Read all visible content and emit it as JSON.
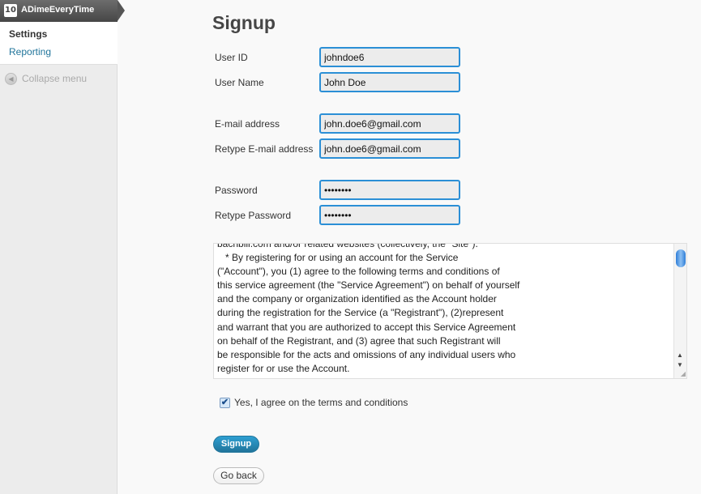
{
  "sidebar": {
    "plugin_icon": "adime-logo-icon",
    "plugin_icon_text": "10",
    "plugin_title": "ADimeEveryTime",
    "items": [
      {
        "label": "Settings",
        "current": true
      },
      {
        "label": "Reporting",
        "current": false
      }
    ],
    "collapse": {
      "icon": "collapse-arrow-icon",
      "label": "Collapse menu"
    }
  },
  "main": {
    "title": "Signup",
    "fields": {
      "user_id": {
        "label": "User ID",
        "value": "johndoe6"
      },
      "user_name": {
        "label": "User Name",
        "value": "John Doe"
      },
      "email": {
        "label": "E-mail address",
        "value": "john.doe6@gmail.com"
      },
      "email_confirm": {
        "label": "Retype E-mail address",
        "value": "john.doe6@gmail.com"
      },
      "password": {
        "label": "Password",
        "value": "xxxxxxxx"
      },
      "password_confirm": {
        "label": "Retype Password",
        "value": "xxxxxxxx"
      }
    },
    "terms_text": "bachbill.com and/or related websites (collectively, the \"Site\").\n   * By registering for or using an account for the Service\n(\"Account\"), you (1) agree to the following terms and conditions of\nthis service agreement (the \"Service Agreement\") on behalf of yourself\nand the company or organization identified as the Account holder\nduring the registration for the Service (a \"Registrant\"), (2)represent\nand warrant that you are authorized to accept this Service Agreement\non behalf of the Registrant, and (3) agree that such Registrant will\nbe responsible for the acts and omissions of any individual users who\nregister for or use the Account.",
    "agree": {
      "checked": true,
      "check_mark": "✔",
      "label": "Yes, I agree on the terms and conditions"
    },
    "signup_button": "Signup",
    "go_back_button": "Go back"
  },
  "colors": {
    "accent": "#21759b",
    "input_border": "#2b8fd6",
    "sidebar_bg": "#ececec",
    "page_bg": "#f9f9f9"
  }
}
